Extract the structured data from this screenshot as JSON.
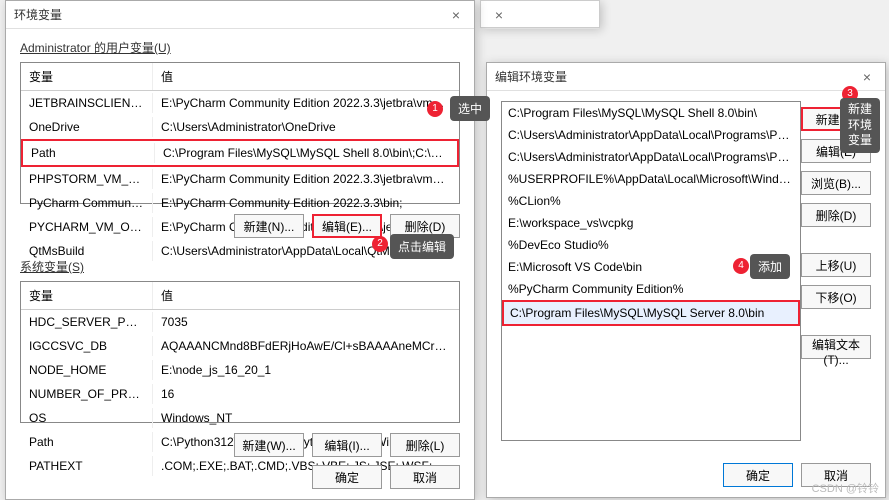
{
  "dialog1": {
    "title": "环境变量",
    "close": "×",
    "user_section": "Administrator 的用户变量(U)",
    "cols": {
      "name": "变量",
      "value": "值"
    },
    "user_vars": [
      {
        "name": "JETBRAINSCLIENT_VM_O...",
        "value": "E:\\PyCharm Community Edition 2022.3.3\\jetbra\\vmoptions\\jet..."
      },
      {
        "name": "OneDrive",
        "value": "C:\\Users\\Administrator\\OneDrive"
      },
      {
        "name": "Path",
        "value": "C:\\Program Files\\MySQL\\MySQL Shell 8.0\\bin\\;C:\\Users\\Admi..."
      },
      {
        "name": "PHPSTORM_VM_OPTIONS",
        "value": "E:\\PyCharm Community Edition 2022.3.3\\jetbra\\vmoptions\\ph..."
      },
      {
        "name": "PyCharm Community Editi...",
        "value": "E:\\PyCharm Community Edition 2022.3.3\\bin;"
      },
      {
        "name": "PYCHARM_VM_OPTIONS",
        "value": "E:\\PyCharm Community Edition 2022.3.3\\jetbra\\vmoptions\\py..."
      },
      {
        "name": "QtMsBuild",
        "value": "C:\\Users\\Administrator\\AppData\\Local\\QtMsBuild"
      }
    ],
    "sys_section": "系统变量(S)",
    "sys_vars": [
      {
        "name": "HDC_SERVER_PORT",
        "value": "7035"
      },
      {
        "name": "IGCCSVC_DB",
        "value": "AQAAANCMnd8BFdERjHoAwE/Cl+sBAAAAneMCrkdqekmEvG..."
      },
      {
        "name": "NODE_HOME",
        "value": "E:\\node_js_16_20_1"
      },
      {
        "name": "NUMBER_OF_PROCESSORS",
        "value": "16"
      },
      {
        "name": "OS",
        "value": "Windows_NT"
      },
      {
        "name": "Path",
        "value": "C:\\Python312\\Scripts\\;C:\\Python312\\;C:\\Windows\\system32;C:..."
      },
      {
        "name": "PATHEXT",
        "value": ".COM;.EXE;.BAT;.CMD;.VBS;.VBE;.JS;.JSE;.WSF;.WSH;.MSC;.PY;.P..."
      }
    ],
    "btns": {
      "new_n": "新建(N)...",
      "edit_e": "编辑(E)...",
      "del_d": "删除(D)",
      "new_w": "新建(W)...",
      "edit_i": "编辑(I)...",
      "del_l": "删除(L)",
      "ok": "确定",
      "cancel": "取消"
    }
  },
  "dialog2": {
    "title": "编辑环境变量",
    "close": "×",
    "paths": [
      "C:\\Program Files\\MySQL\\MySQL Shell 8.0\\bin\\",
      "C:\\Users\\Administrator\\AppData\\Local\\Programs\\Python\\Pytho...",
      "C:\\Users\\Administrator\\AppData\\Local\\Programs\\Python\\Pytho...",
      "%USERPROFILE%\\AppData\\Local\\Microsoft\\WindowsApps",
      "%CLion%",
      "E:\\workspace_vs\\vcpkg",
      "%DevEco Studio%",
      "E:\\Microsoft VS Code\\bin",
      "%PyCharm Community Edition%",
      "C:\\Program Files\\MySQL\\MySQL Server 8.0\\bin"
    ],
    "btns": {
      "new": "新建(N)",
      "edit": "编辑(E)",
      "browse": "浏览(B)...",
      "del": "删除(D)",
      "up": "上移(U)",
      "down": "下移(O)",
      "edit_text": "编辑文本(T)...",
      "ok": "确定",
      "cancel": "取消"
    }
  },
  "annotations": {
    "a1": "选中",
    "a2": "点击编辑",
    "a3": "新建\n环境\n变量",
    "a4": "添加"
  },
  "nums": {
    "n1": "1",
    "n2": "2",
    "n3": "3",
    "n4": "4"
  },
  "watermark": "CSDN @铃铃"
}
